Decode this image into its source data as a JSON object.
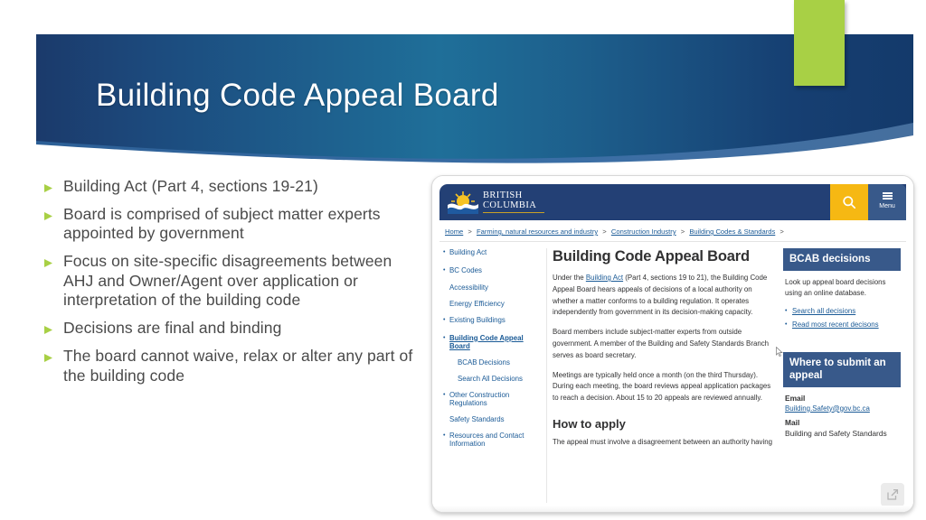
{
  "slide": {
    "title": "Building Code Appeal Board",
    "bullets": [
      "Building Act (Part 4, sections 19-21)",
      "Board is comprised of subject matter experts appointed by government",
      "Focus on site-specific disagreements between AHJ and Owner/Agent over application or interpretation of the building code",
      "Decisions are final and binding",
      "The board cannot waive, relax or alter any part of the building code"
    ],
    "colors": {
      "banner_left": "#1b3a6b",
      "banner_center": "#1f6f99",
      "banner_right": "#143a6b",
      "green_accent": "#a8d045",
      "bullet_marker": "#a8d045",
      "body_text": "#4a4a4a"
    }
  },
  "screenshot": {
    "header": {
      "logo_line1": "BRITISH",
      "logo_line2": "COLUMBIA",
      "search_label": "Search",
      "menu_label": "Menu",
      "colors": {
        "header_bg": "#234075",
        "search_bg": "#f6b813",
        "menu_bg": "#38598a"
      }
    },
    "breadcrumb": [
      "Home",
      "Farming, natural resources and industry",
      "Construction Industry",
      "Building Codes & Standards"
    ],
    "breadcrumb_separator": ">",
    "side_nav": [
      {
        "label": "Building Act",
        "bullet": true,
        "sub": false,
        "active": false
      },
      {
        "label": "BC Codes",
        "bullet": true,
        "sub": false,
        "active": false
      },
      {
        "label": "Accessibility",
        "bullet": false,
        "sub": false,
        "active": false
      },
      {
        "label": "Energy Efficiency",
        "bullet": false,
        "sub": false,
        "active": false
      },
      {
        "label": "Existing Buildings",
        "bullet": true,
        "sub": false,
        "active": false
      },
      {
        "label": "Building Code Appeal Board",
        "bullet": true,
        "sub": false,
        "active": true
      },
      {
        "label": "BCAB Decisions",
        "bullet": false,
        "sub": true,
        "active": false
      },
      {
        "label": "Search All Decisions",
        "bullet": false,
        "sub": true,
        "active": false
      },
      {
        "label": "Other Construction Regulations",
        "bullet": true,
        "sub": false,
        "active": false
      },
      {
        "label": "Safety Standards",
        "bullet": false,
        "sub": false,
        "active": false
      },
      {
        "label": "Resources and Contact Information",
        "bullet": true,
        "sub": false,
        "active": false
      }
    ],
    "main": {
      "h1": "Building Code Appeal Board",
      "para1_before_link": "Under the ",
      "para1_link": "Building Act",
      "para1_after_link": " (Part 4, sections 19 to 21), the Building Code Appeal Board hears appeals of decisions of a local authority on whether a matter conforms to a building regulation. It operates independently from government in its decision-making capacity.",
      "para2": "Board members include subject-matter experts from outside government. A member of the Building and Safety Standards Branch serves as board secretary.",
      "para3": "Meetings are typically held once a month (on the third Thursday). During each meeting, the board reviews appeal application packages to reach a decision. About 15 to 20 appeals are reviewed annually.",
      "h2": "How to apply",
      "para4": "The appeal must involve a disagreement between an authority having"
    },
    "widgets": [
      {
        "title": "BCAB decisions",
        "body": "Look up appeal board decisions using an online database.",
        "links": [
          "Search all decisions",
          "Read most recent decisons"
        ]
      },
      {
        "title": "Where to submit an appeal",
        "fields": [
          {
            "label": "Email",
            "value": "Building.Safety@gov.bc.ca",
            "is_link": true
          },
          {
            "label": "Mail",
            "value": "Building and Safety Standards",
            "is_link": false
          }
        ]
      }
    ],
    "share_icon": "share-external-link-icon"
  }
}
